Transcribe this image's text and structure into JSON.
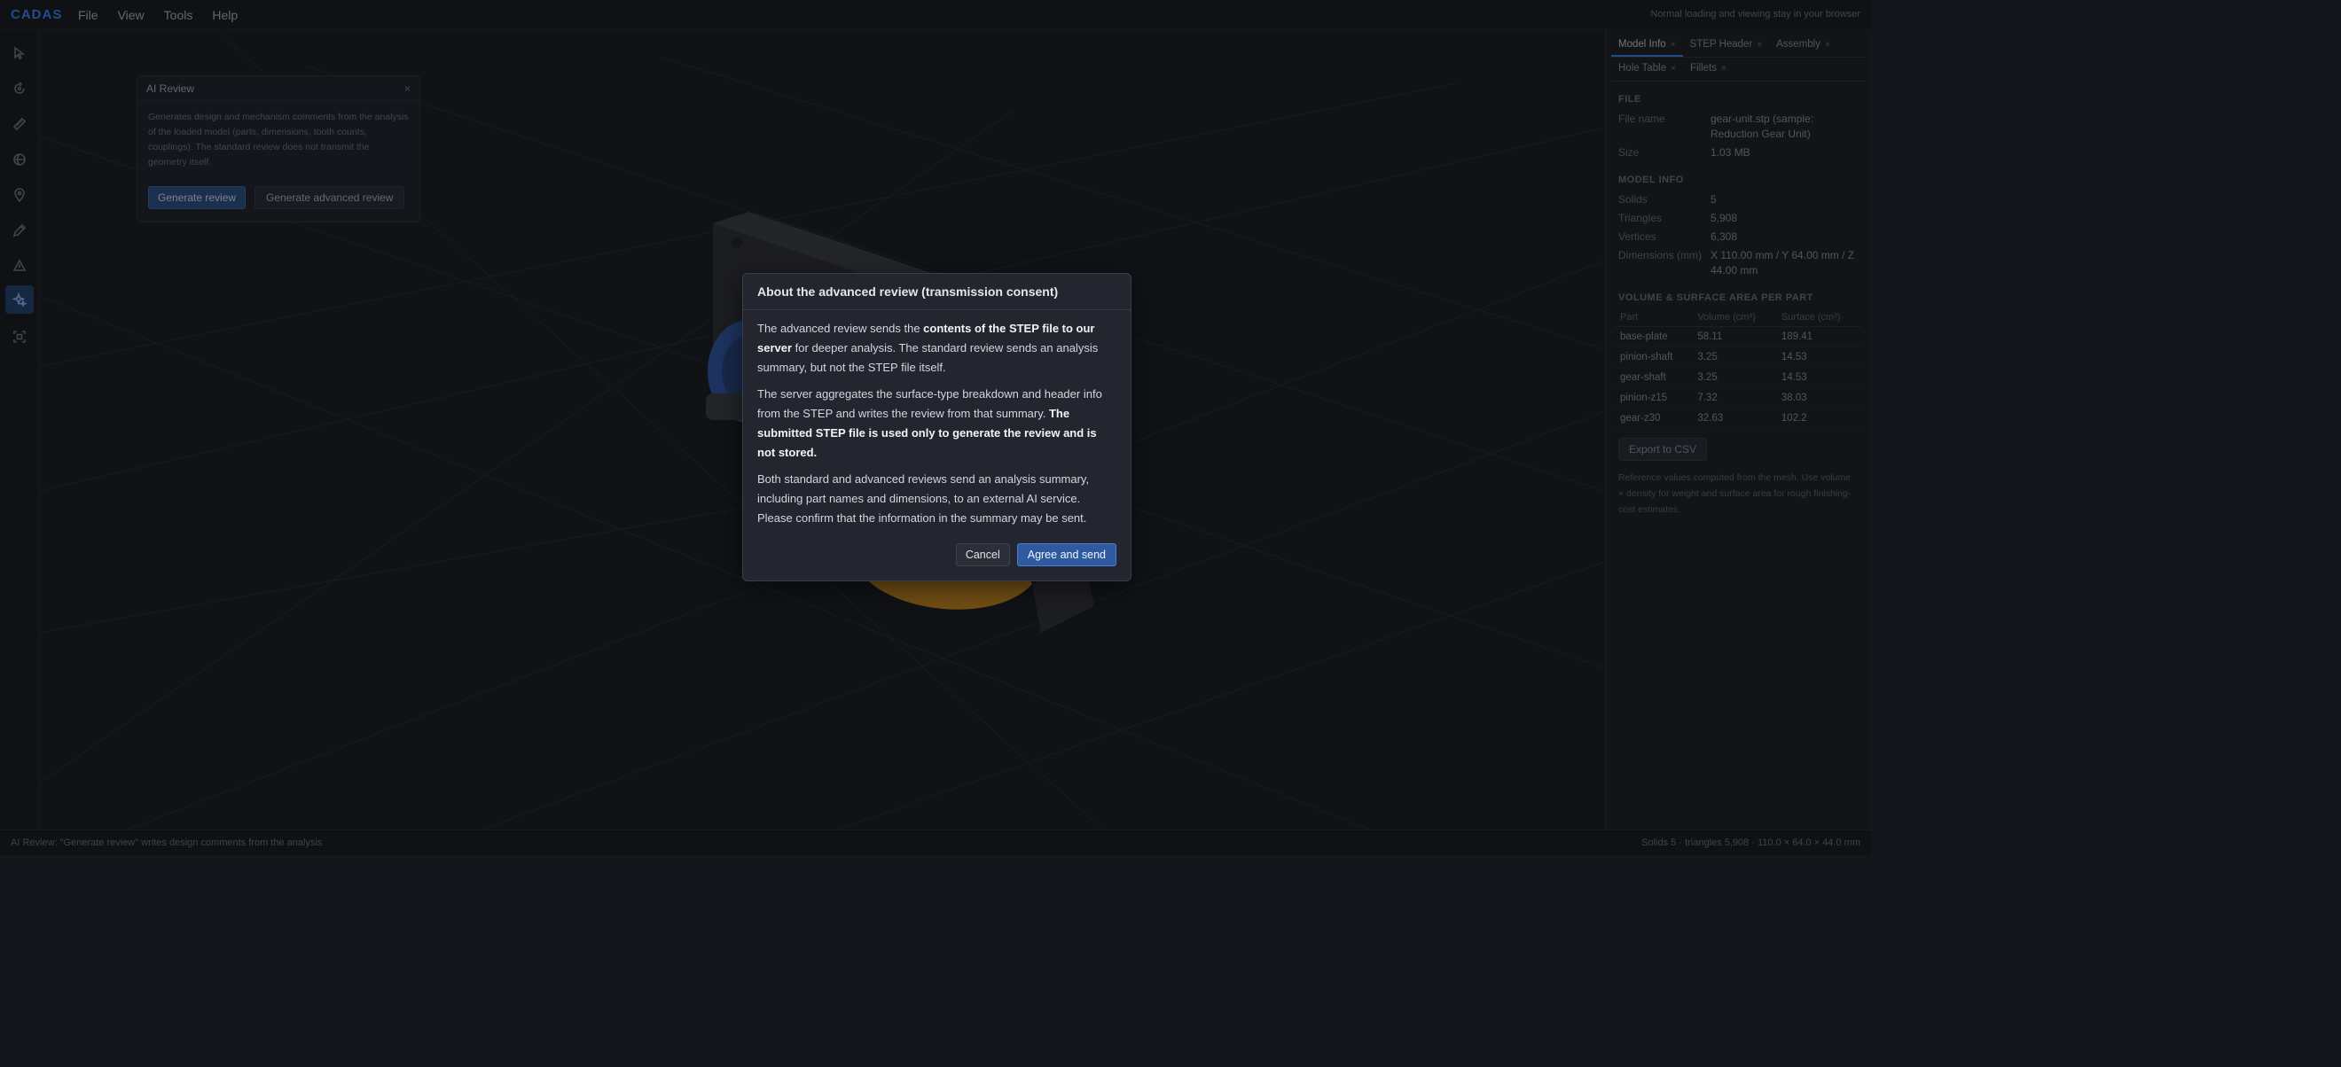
{
  "app": {
    "brand": "CADAS",
    "menu": [
      "File",
      "View",
      "Tools",
      "Help"
    ],
    "hint": "Normal loading and viewing stay in your browser"
  },
  "toolbar": {
    "tools": [
      "select-icon",
      "orbit-icon",
      "measure-icon",
      "section-icon",
      "pin-icon",
      "pencil-icon",
      "triangle-icon",
      "ai-sparkle-icon",
      "fit-icon"
    ],
    "active": "ai-sparkle-icon"
  },
  "ai_panel": {
    "title": "AI Review",
    "close": "×",
    "description": "Generates design and mechanism comments from the analysis of the loaded model (parts, dimensions, tooth counts, couplings). The standard review does not transmit the geometry itself.",
    "generate_label": "Generate review",
    "advanced_label": "Generate advanced review"
  },
  "rightpanel": {
    "tabs_row1": [
      {
        "label": "Model Info",
        "close": "×"
      },
      {
        "label": "STEP Header",
        "close": "×"
      },
      {
        "label": "Assembly",
        "close": "×"
      }
    ],
    "tabs_row2": [
      {
        "label": "Hole Table",
        "close": "×"
      },
      {
        "label": "Fillets",
        "close": "×"
      }
    ],
    "file_section": "FILE",
    "file_name_label": "File name",
    "file_name_value": "gear-unit.stp (sample: Reduction Gear Unit)",
    "size_label": "Size",
    "size_value": "1.03 MB",
    "model_section": "MODEL INFO",
    "solids_label": "Solids",
    "solids_value": "5",
    "triangles_label": "Triangles",
    "triangles_value": "5,908",
    "vertices_label": "Vertices",
    "vertices_value": "6,308",
    "dimensions_label": "Dimensions (mm)",
    "dimensions_value": "X 110.00 mm / Y 64.00 mm / Z 44.00 mm",
    "volume_section": "VOLUME & SURFACE AREA PER PART",
    "table_headers": [
      "Part",
      "Volume (cm³)",
      "Surface (cm²)"
    ],
    "table_rows": [
      [
        "base-plate",
        "58.11",
        "189.41"
      ],
      [
        "pinion-shaft",
        "3.25",
        "14.53"
      ],
      [
        "gear-shaft",
        "3.25",
        "14.53"
      ],
      [
        "pinion-z15",
        "7.32",
        "38.03"
      ],
      [
        "gear-z30",
        "32.63",
        "102.2"
      ]
    ],
    "export_label": "Export to CSV",
    "ref_note": "Reference values computed from the mesh. Use volume × density for weight and surface area for rough finishing-cost estimates."
  },
  "statusbar": {
    "left": "AI Review: \"Generate review\" writes design comments from the analysis",
    "right": "Solids 5 · triangles 5,908 · 110.0 × 64.0 × 44.0 mm"
  },
  "modal": {
    "title": "About the advanced review (transmission consent)",
    "p1_a": "The advanced review sends the ",
    "p1_b": "contents of the STEP file to our server",
    "p1_c": " for deeper analysis. The standard review sends an analysis summary, but not the STEP file itself.",
    "p2_a": "The server aggregates the surface-type breakdown and header info from the STEP and writes the review from that summary. ",
    "p2_b": "The submitted STEP file is used only to generate the review and is not stored.",
    "p3": "Both standard and advanced reviews send an analysis summary, including part names and dimensions, to an external AI service. Please confirm that the information in the summary may be sent.",
    "cancel_label": "Cancel",
    "agree_label": "Agree and send"
  }
}
